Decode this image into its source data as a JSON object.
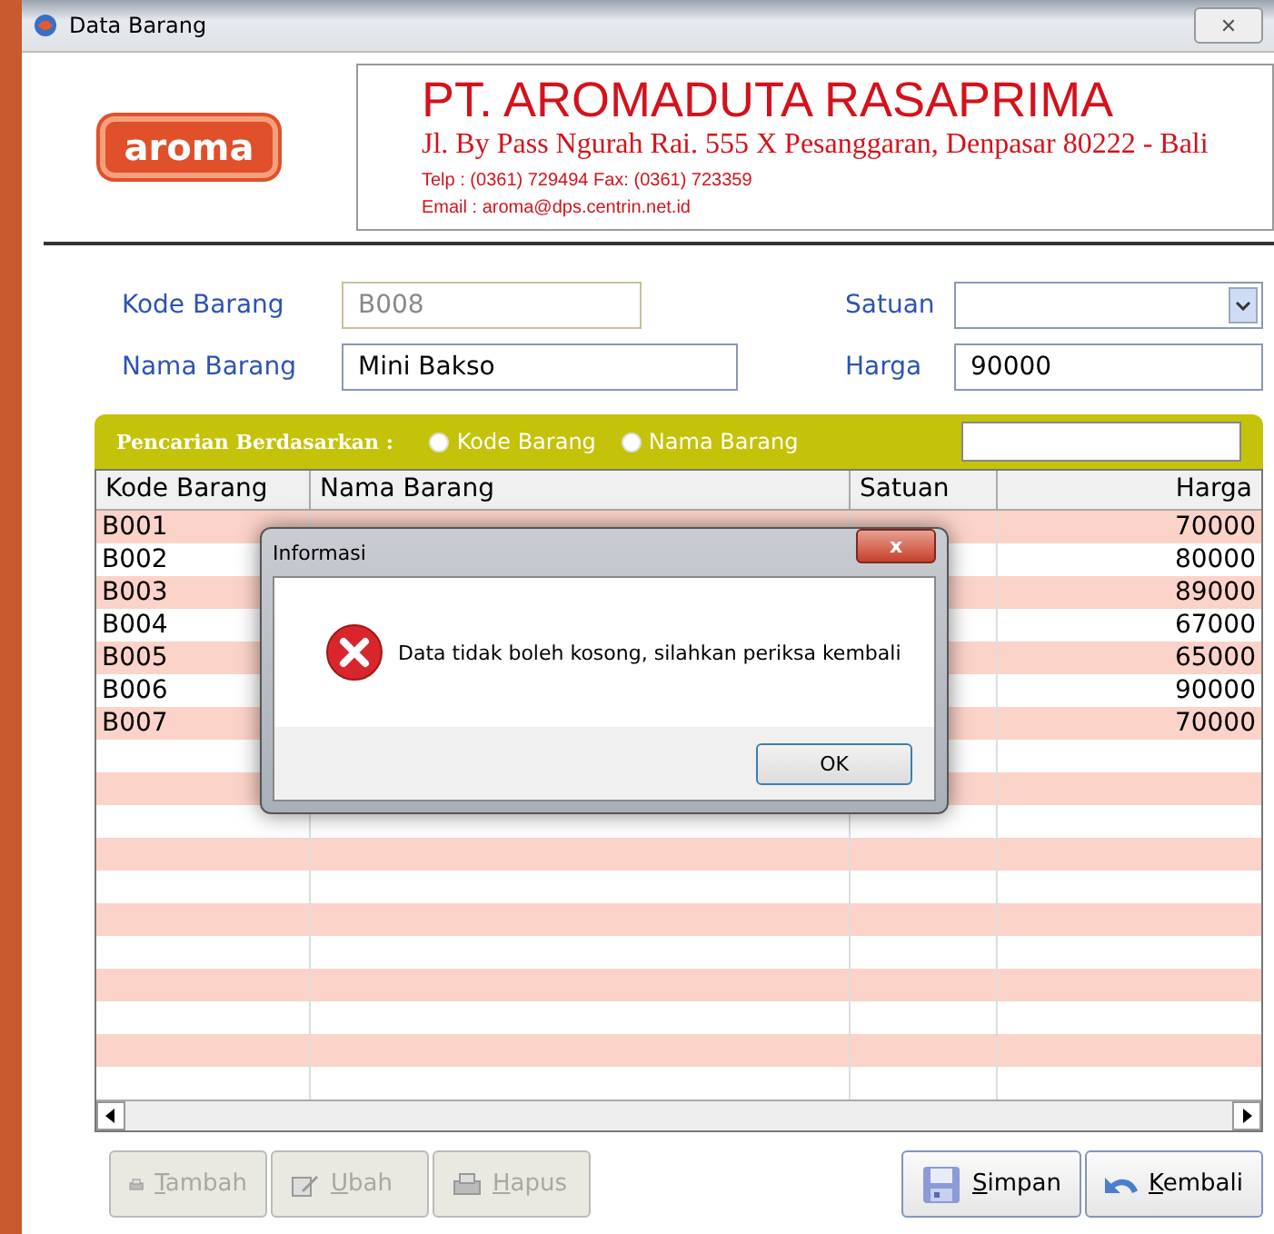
{
  "window": {
    "title": "Data Barang",
    "close": "✕"
  },
  "header": {
    "logo": "aroma",
    "company": "PT. AROMADUTA RASAPRIMA",
    "address": "Jl. By Pass Ngurah Rai. 555 X Pesanggaran, Denpasar 80222 - Bali",
    "phone": "Telp : (0361) 729494   Fax: (0361) 723359",
    "email": "Email : aroma@dps.centrin.net.id"
  },
  "form": {
    "kode_label": "Kode Barang",
    "kode_value": "B008",
    "kode_disabled": true,
    "nama_label": "Nama Barang",
    "nama_value": "Mini Bakso",
    "satuan_label": "Satuan",
    "harga_label": "Harga",
    "harga_value": "90000"
  },
  "search": {
    "label": "Pencarian Berdasarkan :",
    "options": [
      {
        "label": "Kode Barang",
        "selected": false
      },
      {
        "label": "Nama Barang",
        "selected": false
      }
    ]
  },
  "table": {
    "columns": [
      "Kode Barang",
      "Nama Barang",
      "Satuan",
      "Harga"
    ],
    "rows": [
      {
        "kode": "B001",
        "harga": "70000"
      },
      {
        "kode": "B002",
        "harga": "80000"
      },
      {
        "kode": "B003",
        "harga": "89000"
      },
      {
        "kode": "B004",
        "harga": "67000"
      },
      {
        "kode": "B005",
        "harga": "65000"
      },
      {
        "kode": "B006",
        "harga": "90000"
      },
      {
        "kode": "B007",
        "harga": "70000"
      }
    ]
  },
  "buttons": [
    {
      "label": "Tambah",
      "kind": "add",
      "disabled": true
    },
    {
      "label": "Ubah",
      "kind": "edit",
      "disabled": true
    },
    {
      "label": "Hapus",
      "kind": "delete",
      "disabled": true
    },
    {
      "label": "Simpan",
      "kind": "save",
      "disabled": false
    },
    {
      "label": "Kembali",
      "kind": "back",
      "disabled": false
    }
  ],
  "dialog": {
    "title": "Informasi",
    "close": "x",
    "message": "Data tidak boleh kosong, silahkan periksa kembali",
    "button": "OK"
  }
}
